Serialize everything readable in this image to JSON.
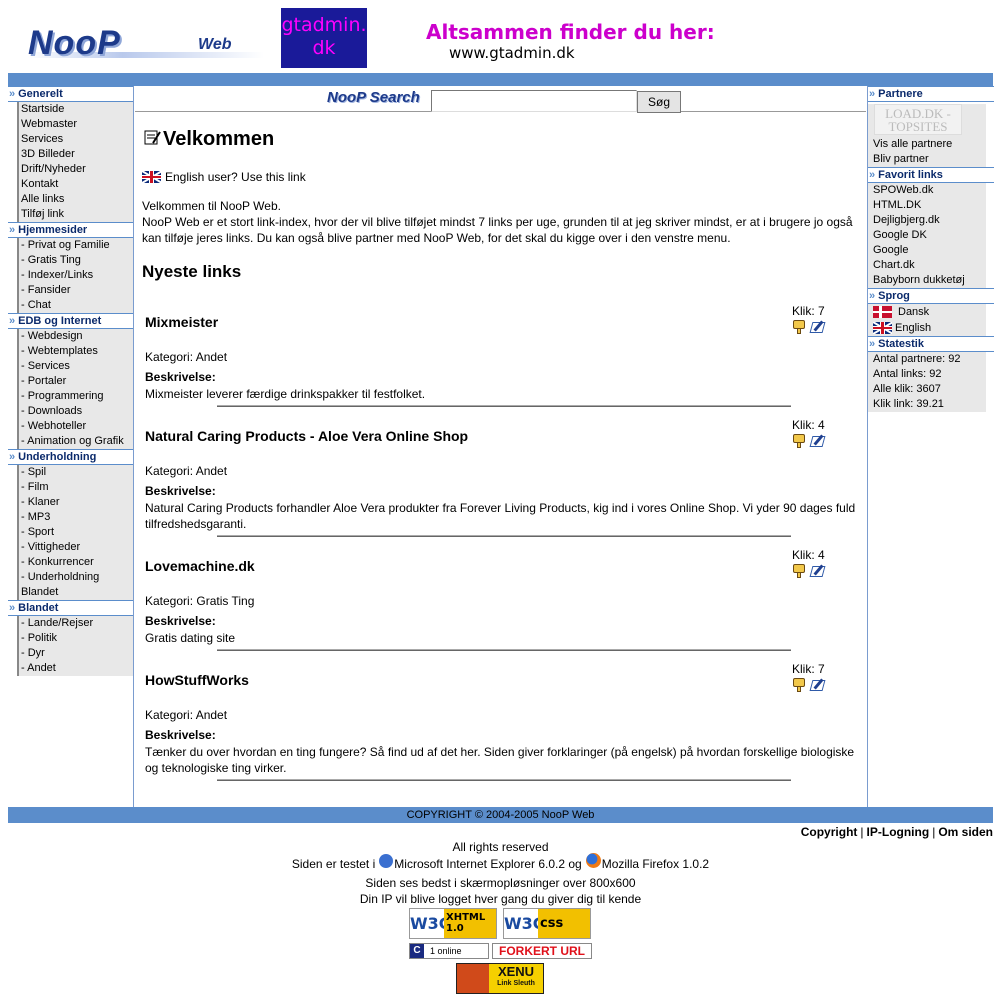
{
  "header": {
    "logo_main": "NooP",
    "logo_sub": "Web",
    "ad_box": "gtadmin.\ndk",
    "ad_line1": "Altsammen finder du her:",
    "ad_line2": "www.gtadmin.dk"
  },
  "left_menu": [
    {
      "title": "Generelt",
      "items": [
        "Startside",
        "Webmaster",
        "Services",
        "3D Billeder",
        "Drift/Nyheder",
        "Kontakt",
        "Alle links",
        "Tilføj link"
      ]
    },
    {
      "title": "Hjemmesider",
      "items": [
        "- Privat og Familie",
        "- Gratis Ting",
        "- Indexer/Links",
        "- Fansider",
        "- Chat"
      ]
    },
    {
      "title": "EDB og Internet",
      "items": [
        "- Webdesign",
        "- Webtemplates",
        "- Services",
        "- Portaler",
        "- Programmering",
        "- Downloads",
        "- Webhoteller",
        "- Animation og Grafik"
      ]
    },
    {
      "title": "Underholdning",
      "items": [
        "- Spil",
        "- Film",
        "- Klaner",
        "- MP3",
        "- Sport",
        "- Vittigheder",
        "- Konkurrencer",
        "- Underholdning",
        "Blandet"
      ]
    },
    {
      "title": "Blandet",
      "items": [
        "- Lande/Rejser",
        "- Politik",
        "- Dyr",
        "- Andet"
      ]
    }
  ],
  "right_menu": {
    "partners": {
      "title": "Partnere",
      "banner": "LOAD.DK - TOPSITES",
      "items": [
        "Vis alle partnere",
        "Bliv partner"
      ]
    },
    "favorites": {
      "title": "Favorit links",
      "items": [
        "SPOWeb.dk",
        "HTML.DK",
        "Dejligbjerg.dk",
        "Google DK",
        "Google",
        "Chart.dk",
        "Babyborn dukketøj"
      ]
    },
    "language": {
      "title": "Sprog",
      "items": [
        "Dansk",
        "English"
      ]
    },
    "stats": {
      "title": "Statestik",
      "items": [
        "Antal partnere: 92",
        "Antal links: 92",
        "Alle klik: 3607",
        "Klik link: 39.21"
      ]
    }
  },
  "search": {
    "logo": "NooP Search",
    "input_value": "",
    "button": "Søg"
  },
  "welcome": {
    "title": "Velkommen",
    "english_link": "English user? Use this link",
    "intro_line1": "Velkommen til NooP Web.",
    "intro_line2": "NooP Web er et stort link-index, hvor der vil blive tilføjet mindst 7 links per uge, grunden til at jeg skriver mindst, er at i brugere jo også kan tilføje jeres links. Du kan også blive partner med NooP Web, for det skal du kigge over i den venstre menu."
  },
  "newest": {
    "title": "Nyeste links",
    "entries": [
      {
        "name": "Mixmeister",
        "clicks": "Klik: 7",
        "category": "Kategori: Andet",
        "desc_label": "Beskrivelse:",
        "desc": "Mixmeister leverer færdige drinkspakker til festfolket."
      },
      {
        "name": "Natural Caring Products - Aloe Vera Online Shop",
        "clicks": "Klik: 4",
        "category": "Kategori: Andet",
        "desc_label": "Beskrivelse:",
        "desc": "Natural Caring Products forhandler Aloe Vera produkter fra Forever Living Products, kig ind i vores Online Shop. Vi yder 90 dages fuld tilfredshedsgaranti."
      },
      {
        "name": "Lovemachine.dk",
        "clicks": "Klik: 4",
        "category": "Kategori: Gratis Ting",
        "desc_label": "Beskrivelse:",
        "desc": "Gratis dating site"
      },
      {
        "name": "HowStuffWorks",
        "clicks": "Klik: 7",
        "category": "Kategori: Andet",
        "desc_label": "Beskrivelse:",
        "desc": "Tænker du over hvordan en ting fungere? Så find ud af det her. Siden giver forklaringer (på engelsk) på hvordan forskellige biologiske og teknologiske ting virker."
      }
    ]
  },
  "footer": {
    "copyright": "COPYRIGHT © 2004-2005 NooP Web",
    "links": [
      "Copyright",
      "IP-Logning",
      "Om siden"
    ],
    "rights": "All rights reserved",
    "tested_prefix": "Siden er testet i",
    "ie": "Microsoft Internet Explorer 6.0.2 og",
    "firefox": "Mozilla Firefox 1.0.2",
    "resolution": "Siden ses bedst i skærmopløsninger over 800x600",
    "ip_notice": "Din IP vil blive logget hver gang du giver dig til kende",
    "xhtml_badge": "XHTML\n1.0",
    "css_badge": "css",
    "w3c": "W3C",
    "online_c": "C",
    "online": "1 online",
    "wrong_url": "FORKERT URL",
    "xenu": "XENU",
    "xenu_sub": "Link Sleuth"
  },
  "colors": {
    "bar": "#5b8dcb",
    "sidebar_bg": "#e8e8e8",
    "heading": "#0b2a6b"
  }
}
